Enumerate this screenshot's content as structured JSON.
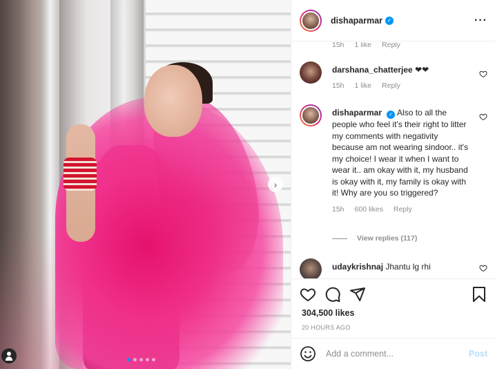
{
  "post": {
    "username": "dishaparmar",
    "verified": true,
    "image_dots": 5,
    "active_dot": 1
  },
  "comments": [
    {
      "username": "darshana_chatterjee",
      "text": "❤❤",
      "time": "15h",
      "likes": "1 like",
      "reply": "Reply"
    },
    {
      "username": "dishaparmar",
      "text": "Also to all the people who feel it's their right to litter my comments with negativity because am not wearing sindoor.. it's my choice! I wear it when I want to wear it.. am okay with it, my husband is okay with it, my family is okay with it! Why are you so triggered?",
      "time": "15h",
      "likes": "600 likes",
      "reply": "Reply",
      "view_replies": "View replies (117)"
    },
    {
      "username": "udaykrishnaj",
      "text": "Jhantu lg rhi"
    }
  ],
  "partial_comment": {
    "time": "15h",
    "likes": "1 like",
    "reply": "Reply"
  },
  "likes_count": "304,500 likes",
  "timestamp": "20 HOURS AGO",
  "add_comment": {
    "placeholder": "Add a comment...",
    "post_label": "Post"
  },
  "icons": {
    "like": "heart-icon",
    "comment": "comment-icon",
    "share": "paper-plane-icon",
    "save": "bookmark-icon",
    "emoji": "smiley-icon",
    "more": "more-dots-icon",
    "next": "chevron-right-icon",
    "tag": "user-tag-icon"
  },
  "colors": {
    "verified": "#0095f6",
    "post_disabled": "#b2dffc",
    "muted": "#8e8e8e"
  }
}
